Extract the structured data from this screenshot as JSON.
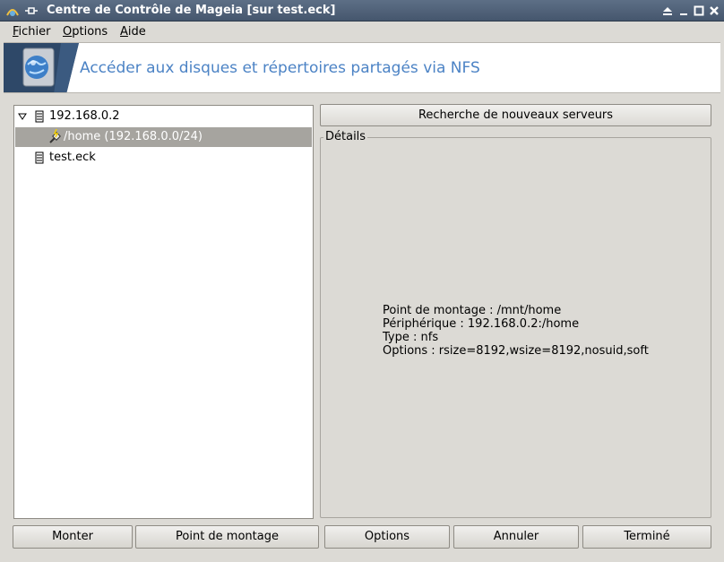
{
  "window": {
    "title": "Centre de Contrôle de Mageia  [sur test.eck]",
    "controls": [
      "shade-icon",
      "minimize-icon",
      "maximize-icon",
      "close-icon"
    ]
  },
  "menu": [
    {
      "label": "Fichier",
      "mnemonic": "F"
    },
    {
      "label": "Options",
      "mnemonic": "O"
    },
    {
      "label": "Aide",
      "mnemonic": "A"
    }
  ],
  "banner": {
    "title": "Accéder aux disques et répertoires partagés via NFS",
    "icon": "nfs-disk-globe-icon"
  },
  "tree": {
    "items": [
      {
        "label": "192.168.0.2",
        "icon": "server-icon",
        "expanded": true,
        "level": 0
      },
      {
        "label": "/home (192.168.0.0/24)",
        "icon": "share-plug-icon",
        "level": 1,
        "selected": true
      },
      {
        "label": "test.eck",
        "icon": "server-icon",
        "level": 0
      }
    ]
  },
  "search_button": "Recherche de nouveaux serveurs",
  "details": {
    "legend": "Détails",
    "lines": [
      "Point de montage : /mnt/home",
      "Périphérique : 192.168.0.2:/home",
      "Type : nfs",
      "Options : rsize=8192,wsize=8192,nosuid,soft"
    ]
  },
  "buttons": {
    "mount": "Monter",
    "mount_point": "Point de montage",
    "options": "Options",
    "cancel": "Annuler",
    "done": "Terminé"
  },
  "colors": {
    "titlebar": "#4f6078",
    "banner_text": "#4c83c5",
    "selection": "#a6a49f",
    "window_bg": "#dcdad5"
  }
}
